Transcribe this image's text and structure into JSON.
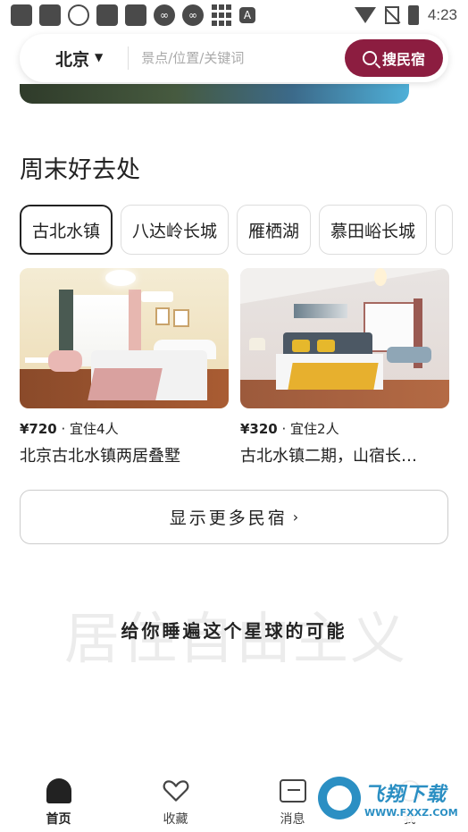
{
  "status_bar": {
    "time": "4:23",
    "icons": [
      "app-icon",
      "app-icon",
      "cat-icon",
      "app-icon",
      "app-icon",
      "infinity-icon",
      "infinity-icon",
      "grid-icon",
      "font-icon"
    ]
  },
  "search": {
    "city": "北京",
    "placeholder": "景点/位置/关键词",
    "button_label": "搜民宿"
  },
  "section": {
    "title": "周末好去处",
    "chips": [
      "古北水镇",
      "八达岭长城",
      "雁栖湖",
      "慕田峪长城"
    ],
    "active_chip": "古北水镇"
  },
  "cards": [
    {
      "price": "¥720",
      "capacity": " · 宜住4人",
      "title": "北京古北水镇两居叠墅"
    },
    {
      "price": "¥320",
      "capacity": " · 宜住2人",
      "title": "古北水镇二期，山宿长…"
    }
  ],
  "show_more": {
    "label": "显示更多民宿",
    "arrow": "›"
  },
  "slogan": {
    "background_text": "居住自由主义",
    "text": "给你睡遍这个星球的可能"
  },
  "tab_bar": {
    "tabs": [
      {
        "label": "首页",
        "icon": "home-icon",
        "active": true
      },
      {
        "label": "收藏",
        "icon": "heart-icon",
        "active": false
      },
      {
        "label": "消息",
        "icon": "message-icon",
        "active": false
      },
      {
        "label": "我",
        "icon": "user-icon",
        "active": false
      }
    ]
  },
  "watermark": {
    "title": "飞翔下载",
    "url": "WWW.FXXZ.COM"
  },
  "colors": {
    "brand": "#8c1d40",
    "text": "#222222",
    "border": "#dddddd"
  }
}
